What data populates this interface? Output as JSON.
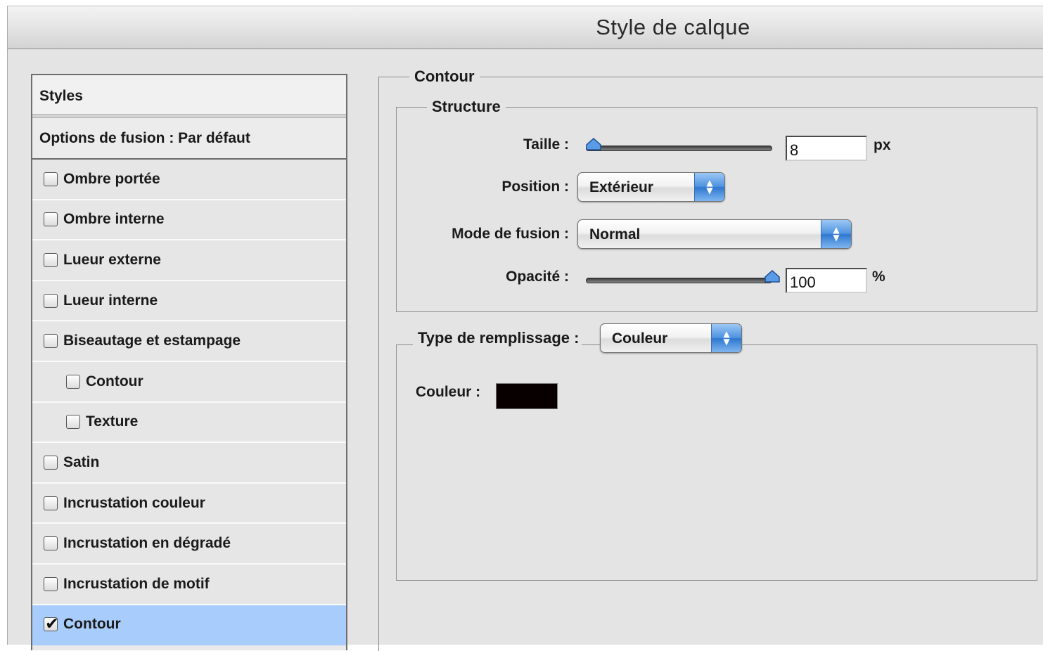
{
  "window": {
    "title": "Style de calque"
  },
  "styles_list": {
    "header": "Styles",
    "options": "Options de fusion : Par défaut",
    "items": [
      {
        "label": "Ombre portée",
        "checked": false,
        "indent": false,
        "selected": false
      },
      {
        "label": "Ombre interne",
        "checked": false,
        "indent": false,
        "selected": false
      },
      {
        "label": "Lueur externe",
        "checked": false,
        "indent": false,
        "selected": false
      },
      {
        "label": "Lueur interne",
        "checked": false,
        "indent": false,
        "selected": false
      },
      {
        "label": "Biseautage et estampage",
        "checked": false,
        "indent": false,
        "selected": false
      },
      {
        "label": "Contour",
        "checked": false,
        "indent": true,
        "selected": false
      },
      {
        "label": "Texture",
        "checked": false,
        "indent": true,
        "selected": false
      },
      {
        "label": "Satin",
        "checked": false,
        "indent": false,
        "selected": false
      },
      {
        "label": "Incrustation couleur",
        "checked": false,
        "indent": false,
        "selected": false
      },
      {
        "label": "Incrustation en dégradé",
        "checked": false,
        "indent": false,
        "selected": false
      },
      {
        "label": "Incrustation de motif",
        "checked": false,
        "indent": false,
        "selected": false
      },
      {
        "label": "Contour",
        "checked": true,
        "indent": false,
        "selected": true
      }
    ]
  },
  "panel": {
    "group_title": "Contour",
    "structure": {
      "title": "Structure",
      "size_label": "Taille :",
      "size_value": "8",
      "size_unit": "px",
      "size_slider_fraction": 0.04,
      "position_label": "Position :",
      "position_value": "Extérieur",
      "blend_label": "Mode de fusion :",
      "blend_value": "Normal",
      "opacity_label": "Opacité :",
      "opacity_value": "100",
      "opacity_unit": "%",
      "opacity_slider_fraction": 1.0
    },
    "fill": {
      "type_label": "Type de remplissage :",
      "type_value": "Couleur",
      "color_label": "Couleur :",
      "color_hex": "#080000"
    }
  },
  "colors": {
    "selection": "#a8cdfd",
    "popup_accent": "#3b85dc"
  }
}
